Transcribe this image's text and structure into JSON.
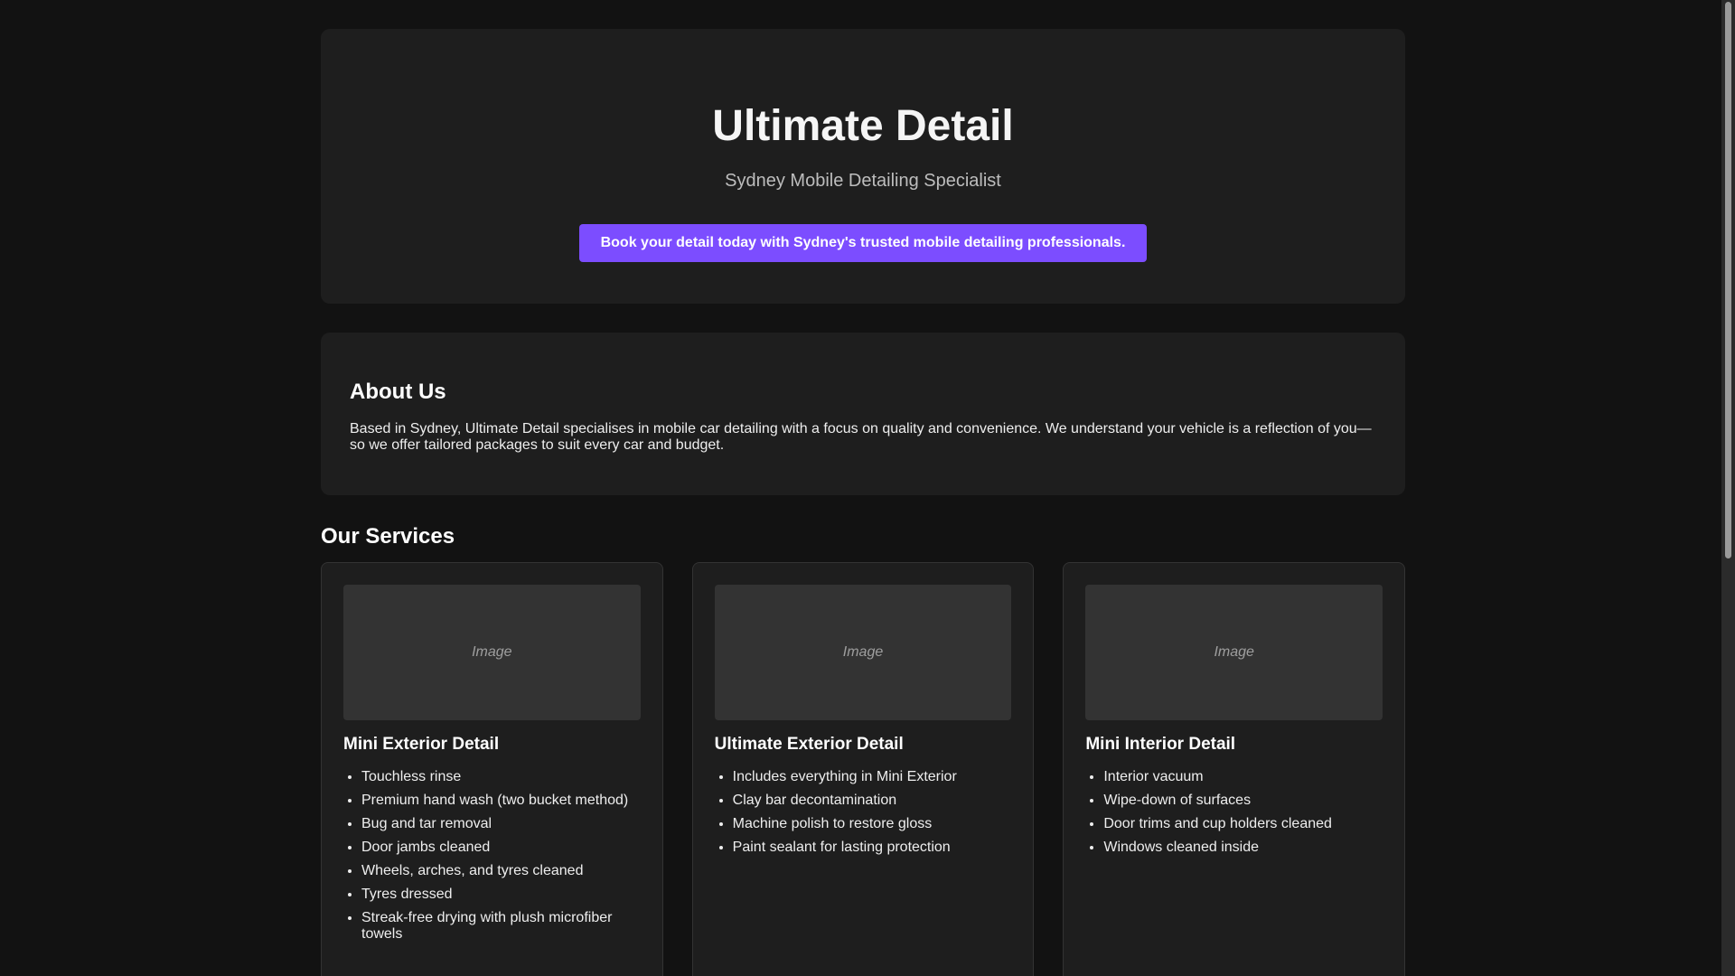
{
  "hero": {
    "title": "Ultimate Detail",
    "subtitle": "Sydney Mobile Detailing Specialist",
    "cta_label": "Book your detail today with Sydney's trusted mobile detailing professionals."
  },
  "about": {
    "heading": "About Us",
    "body": "Based in Sydney, Ultimate Detail specialises in mobile car detailing with a focus on quality and convenience. We understand your vehicle is a reflection of you—so we offer tailored packages to suit every car and budget."
  },
  "services": {
    "heading": "Our Services",
    "items": [
      {
        "image_label": "Image",
        "title": "Mini Exterior Detail",
        "features": [
          "Touchless rinse",
          "Premium hand wash (two bucket method)",
          "Bug and tar removal",
          "Door jambs cleaned",
          "Wheels, arches, and tyres cleaned",
          "Tyres dressed",
          "Streak-free drying with plush microfiber towels"
        ]
      },
      {
        "image_label": "Image",
        "title": "Ultimate Exterior Detail",
        "features": [
          "Includes everything in Mini Exterior",
          "Clay bar decontamination",
          "Machine polish to restore gloss",
          "Paint sealant for lasting protection"
        ]
      },
      {
        "image_label": "Image",
        "title": "Mini Interior Detail",
        "features": [
          "Interior vacuum",
          "Wipe-down of surfaces",
          "Door trims and cup holders cleaned",
          "Windows cleaned inside"
        ]
      }
    ]
  },
  "colors": {
    "background": "#121212",
    "card": "#1e1e1e",
    "accent": "#7c4dff"
  }
}
